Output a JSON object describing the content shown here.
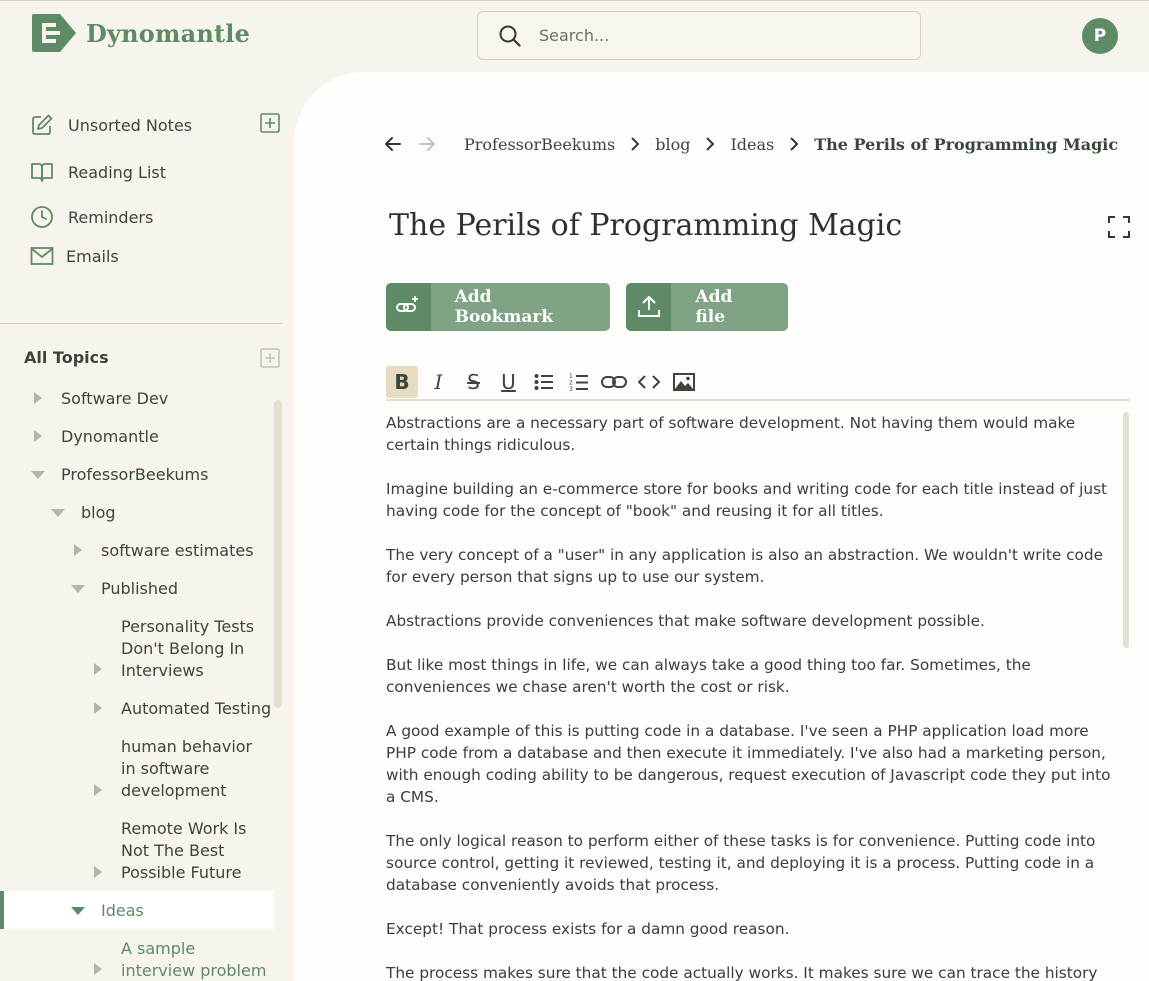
{
  "app": {
    "name": "Dynomantle",
    "avatar_initial": "P"
  },
  "search": {
    "placeholder": "Search..."
  },
  "nav": {
    "unsorted_notes": "Unsorted Notes",
    "reading_list": "Reading List",
    "reminders": "Reminders",
    "emails": "Emails"
  },
  "topics": {
    "title": "All Topics",
    "items": [
      {
        "label": "Software Dev",
        "expanded": false
      },
      {
        "label": "Dynomantle",
        "expanded": false
      },
      {
        "label": "ProfessorBeekums",
        "expanded": true
      },
      {
        "label": "blog",
        "expanded": true
      },
      {
        "label": "software estimates",
        "expanded": false
      },
      {
        "label": "Published",
        "expanded": true
      },
      {
        "label": "Personality Tests Don't Belong In Interviews",
        "expanded": false
      },
      {
        "label": "Automated Testing",
        "expanded": false
      },
      {
        "label": "human behavior in software development",
        "expanded": false
      },
      {
        "label": "Remote Work Is Not The Best Possible Future",
        "expanded": false
      },
      {
        "label": "Ideas",
        "expanded": true,
        "selected": true
      },
      {
        "label": "A sample interview problem",
        "expanded": false
      }
    ]
  },
  "breadcrumb": [
    "ProfessorBeekums",
    "blog",
    "Ideas",
    "The Perils of Programming Magic"
  ],
  "note": {
    "title": "The Perils of Programming Magic",
    "add_bookmark": "Add Bookmark",
    "add_file": "Add file",
    "paragraphs": [
      "Abstractions are a necessary part of software development.  Not having them would make certain things ridiculous.",
      "Imagine building an e-commerce store for books and writing code for each title instead of just having code for the concept of \"book\" and reusing it for all titles.",
      "The very concept of a \"user\" in any application is also an abstraction. We wouldn't write code for every person that signs up to use our system.",
      "Abstractions provide conveniences that make software development possible.",
      "But like most things in life, we can always take a good thing too far. Sometimes, the conveniences we chase aren't worth the cost or risk.",
      "A good example of this is putting code in a database. I've seen a PHP application load more PHP code from a database and then execute it immediately. I've also had a marketing person, with enough coding ability to be dangerous, request execution of Javascript code they put into a CMS.",
      "The only logical reason to perform either of these tasks is for convenience. Putting code into source control, getting it reviewed, testing it, and deploying it is a process. Putting code in a database conveniently avoids that process.",
      "Except! That process exists for a damn good reason.",
      "The process makes sure that the code actually works. It makes sure we can trace the history of that code. It makes sure we can rollback the code to a working state if we ever ship something"
    ]
  },
  "colors": {
    "accent": "#5e8a66",
    "accent_light": "#7fa384",
    "background": "#f6f4ec"
  }
}
